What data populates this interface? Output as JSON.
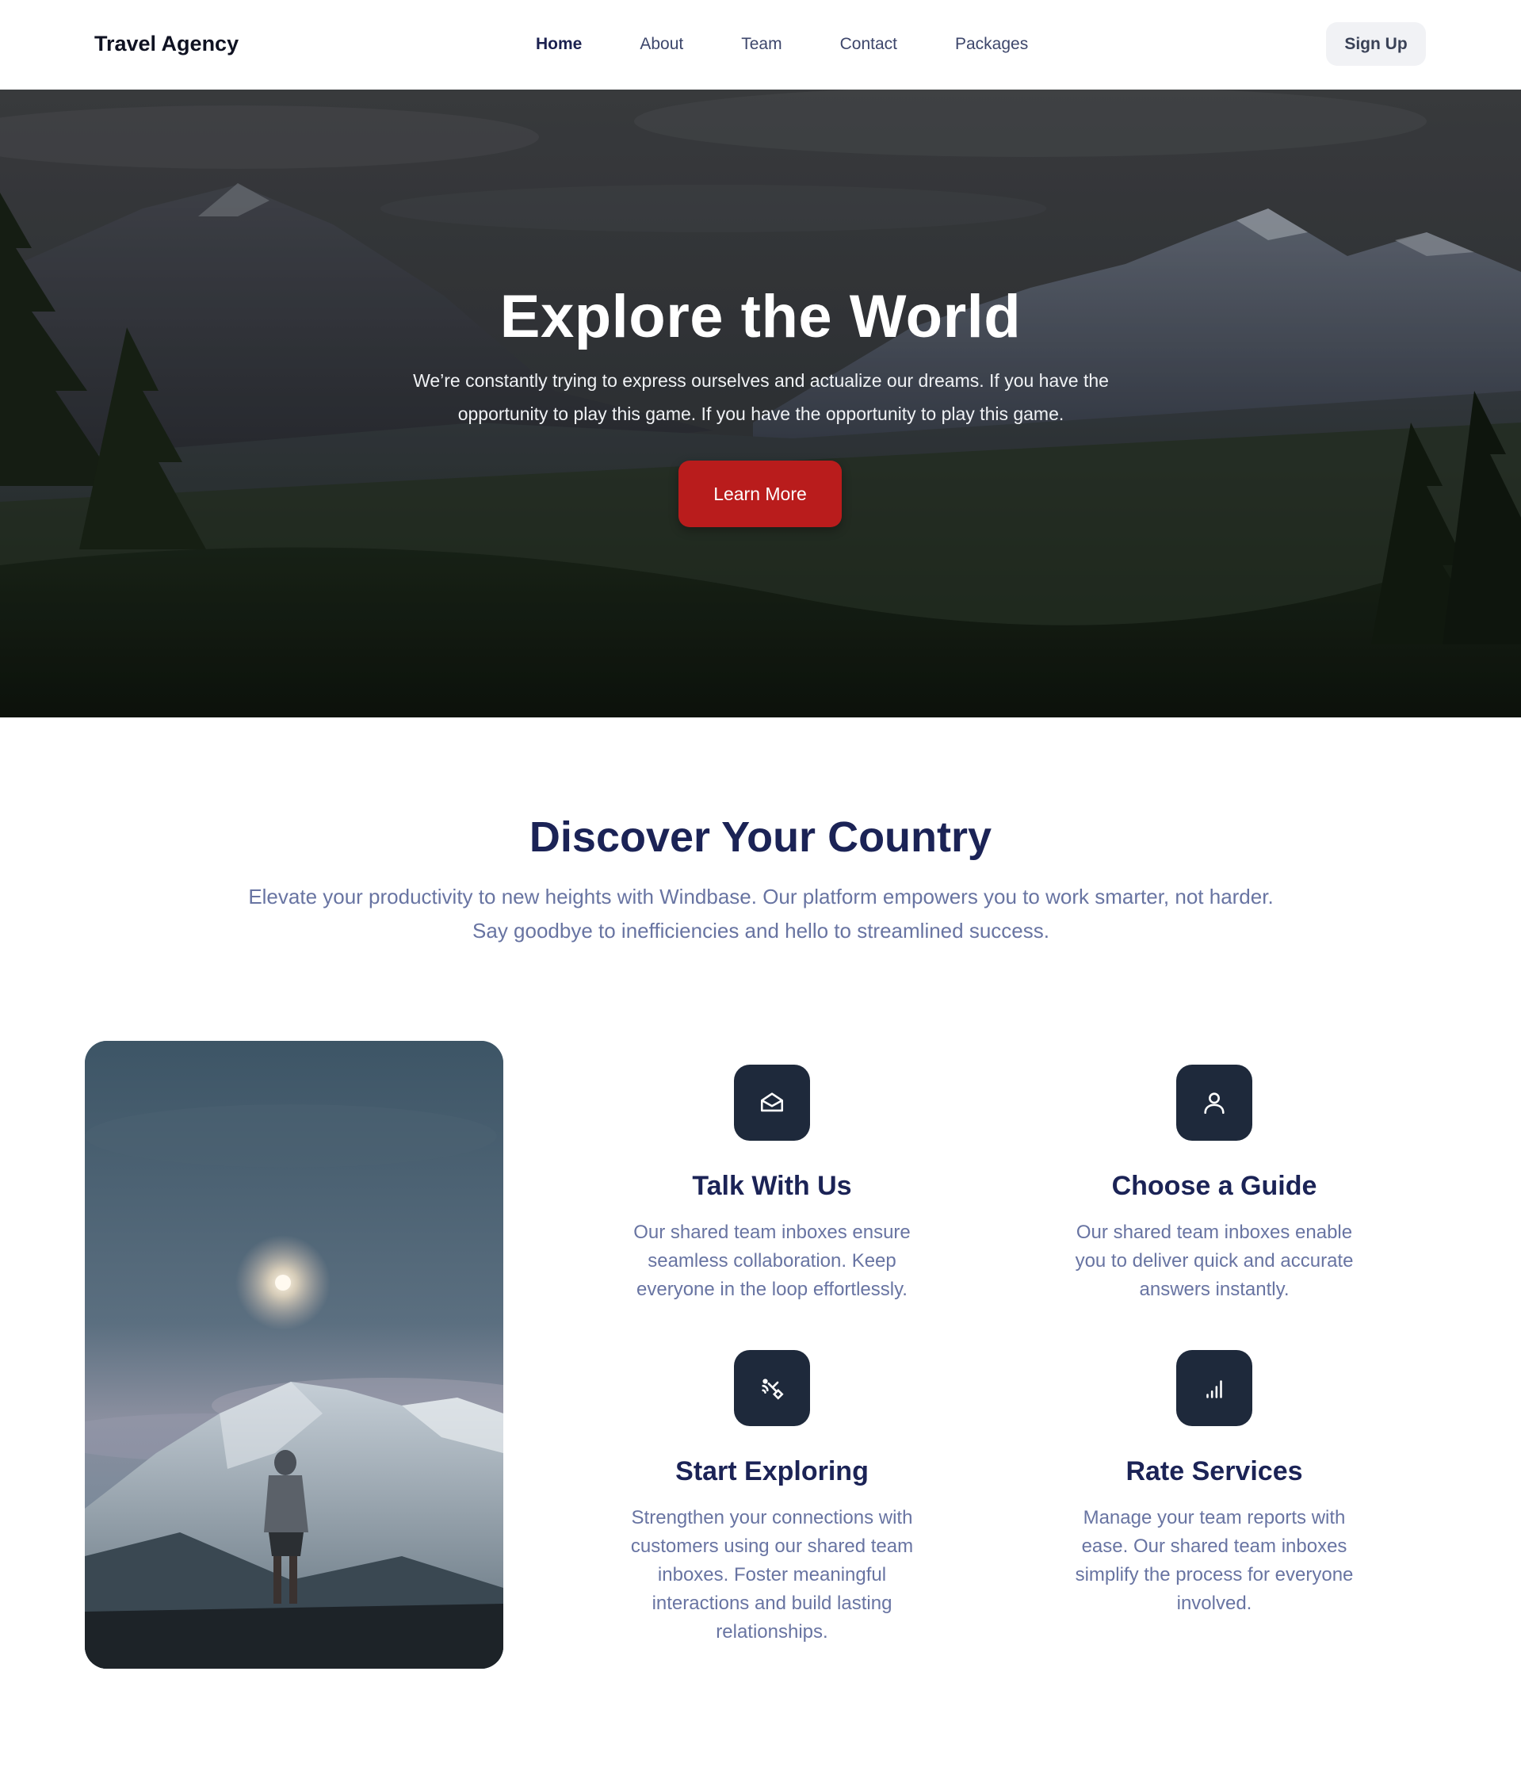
{
  "nav": {
    "brand": "Travel Agency",
    "links": [
      {
        "label": "Home",
        "active": true
      },
      {
        "label": "About",
        "active": false
      },
      {
        "label": "Team",
        "active": false
      },
      {
        "label": "Contact",
        "active": false
      },
      {
        "label": "Packages",
        "active": false
      }
    ],
    "signup_label": "Sign Up"
  },
  "hero": {
    "title": "Explore the World",
    "text": "We’re constantly trying to express ourselves and actualize our dreams. If you have the opportunity to play this game. If you have the opportunity to play this game.",
    "button_label": "Learn More",
    "button_color": "#b91c1c"
  },
  "discover": {
    "title": "Discover Your Country",
    "subtitle": "Elevate your productivity to new heights with Windbase. Our platform empowers you to work smarter, not harder. Say goodbye to inefficiencies and hello to streamlined success.",
    "features": [
      {
        "icon": "open-envelope-icon",
        "title": "Talk With Us",
        "text": "Our shared team inboxes ensure seamless collaboration. Keep everyone in the loop effortlessly."
      },
      {
        "icon": "user-icon",
        "title": "Choose a Guide",
        "text": "Our shared team inboxes enable you to deliver quick and accurate answers instantly."
      },
      {
        "icon": "satellite-icon",
        "title": "Start Exploring",
        "text": "Strengthen your connections with customers using our shared team inboxes. Foster meaningful interactions and build lasting relationships."
      },
      {
        "icon": "signal-bars-icon",
        "title": "Rate Services",
        "text": "Manage your team reports with ease. Our shared team inboxes simplify the process for everyone involved."
      }
    ]
  },
  "colors": {
    "heading": "#1b2356",
    "muted_text": "#6874a2",
    "icon_tile": "#1e293b"
  }
}
